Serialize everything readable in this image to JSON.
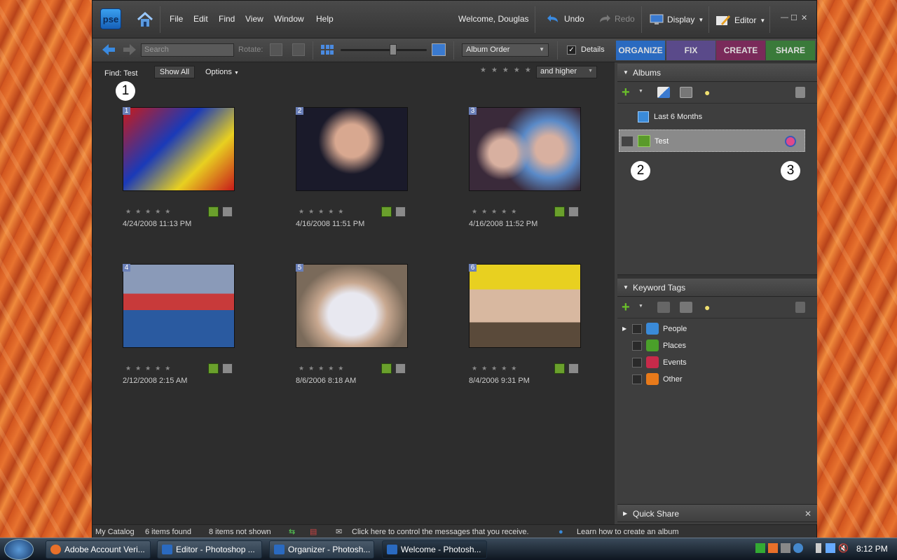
{
  "app": {
    "logo": "pse",
    "menu": [
      "File",
      "Edit",
      "Find",
      "View",
      "Window",
      "Help"
    ],
    "welcome": "Welcome, Douglas",
    "undo": "Undo",
    "redo": "Redo",
    "display": "Display",
    "editor": "Editor"
  },
  "toolbar": {
    "search_placeholder": "Search",
    "rotate_label": "Rotate:",
    "sort": "Album Order",
    "details_label": "Details",
    "details_checked": true
  },
  "tabs": [
    {
      "label": "ORGANIZE",
      "color": "#2a6ac0"
    },
    {
      "label": "FIX",
      "color": "#5a4a8a"
    },
    {
      "label": "CREATE",
      "color": "#7a2a5a"
    },
    {
      "label": "SHARE",
      "color": "#3a7a3a"
    }
  ],
  "find": {
    "label": "Find: Test",
    "show_all": "Show All",
    "options": "Options",
    "rating_filter": "and higher"
  },
  "photos": [
    {
      "num": "1",
      "date": "4/24/2008 11:13 PM",
      "colors": [
        "#c81a1a",
        "#1a3ab8",
        "#e8d020"
      ]
    },
    {
      "num": "2",
      "date": "4/16/2008 11:51 PM",
      "colors": [
        "#1a1a2a",
        "#d8a890",
        "#2a3a6a"
      ]
    },
    {
      "num": "3",
      "date": "4/16/2008 11:52 PM",
      "colors": [
        "#3a2a3a",
        "#d8b0a0",
        "#5a8ac8"
      ]
    },
    {
      "num": "4",
      "date": "2/12/2008 2:15 AM",
      "colors": [
        "#8a9ab8",
        "#2a5aa0",
        "#c83a3a"
      ]
    },
    {
      "num": "5",
      "date": "8/6/2006 8:18 AM",
      "colors": [
        "#7a6a5a",
        "#e8e8f0",
        "#c8a890"
      ]
    },
    {
      "num": "6",
      "date": "8/4/2006 9:31 PM",
      "colors": [
        "#e8d020",
        "#5a4a3a",
        "#d8b8a0"
      ]
    }
  ],
  "callouts": [
    "1",
    "2",
    "3"
  ],
  "albums": {
    "title": "Albums",
    "items": [
      {
        "label": "Last 6 Months",
        "selected": false
      },
      {
        "label": "Test",
        "selected": true
      }
    ]
  },
  "keyword_tags": {
    "title": "Keyword Tags",
    "items": [
      {
        "label": "People",
        "color": "#3a8ad8"
      },
      {
        "label": "Places",
        "color": "#4aa02a"
      },
      {
        "label": "Events",
        "color": "#c82a4a"
      },
      {
        "label": "Other",
        "color": "#e87a1a"
      }
    ]
  },
  "quick_share": "Quick Share",
  "status": {
    "catalog": "My Catalog",
    "found": "6 items found",
    "not_shown": "8 items not shown",
    "messages": "Click here to control the messages that you receive.",
    "learn": "Learn how to create an album"
  },
  "taskbar": {
    "tasks": [
      {
        "label": "Adobe Account Veri...",
        "active": false
      },
      {
        "label": "Editor - Photoshop ...",
        "active": false
      },
      {
        "label": "Organizer - Photosh...",
        "active": false
      },
      {
        "label": "Welcome - Photosh...",
        "active": true
      }
    ],
    "clock": "8:12 PM"
  }
}
